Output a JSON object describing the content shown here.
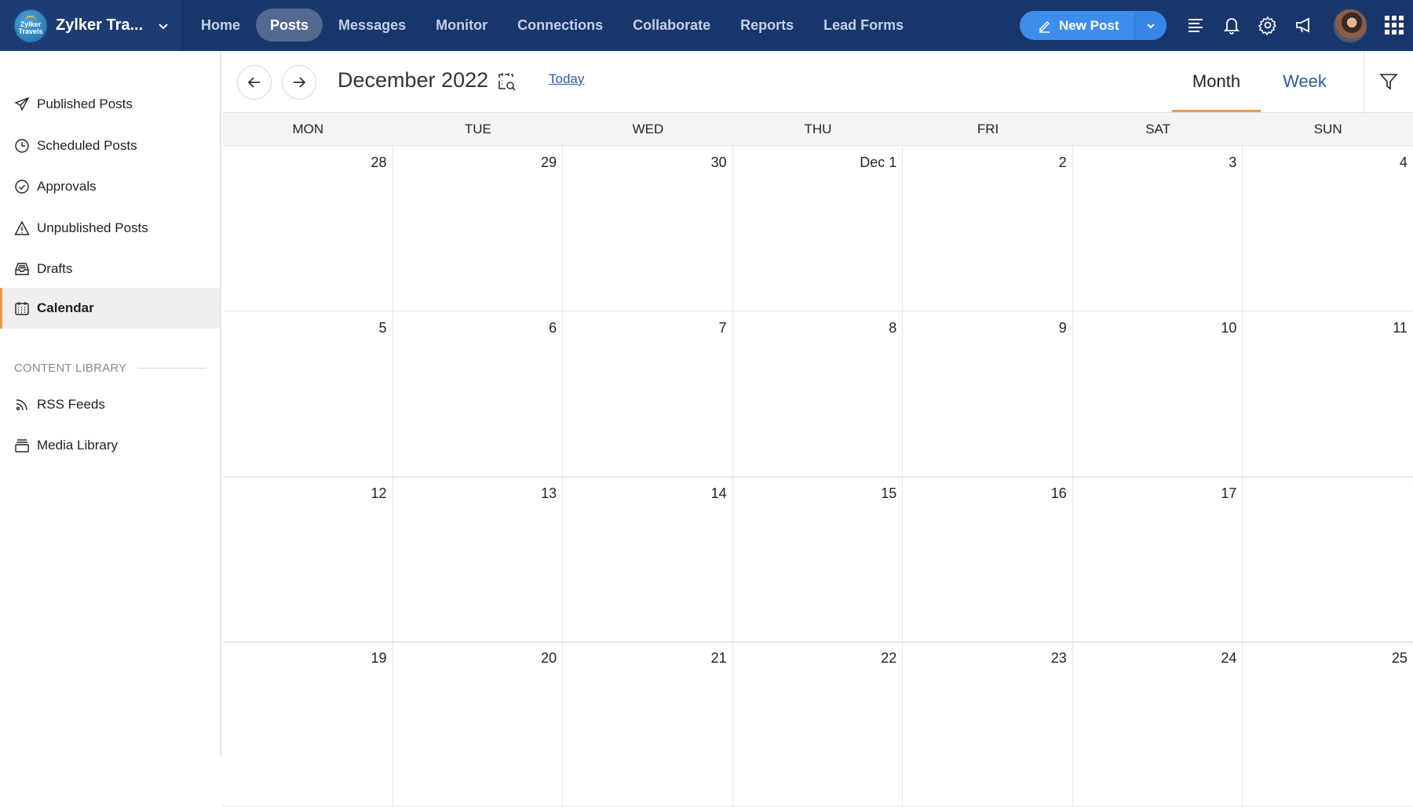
{
  "brand": {
    "name": "Zylker Tra...",
    "logo_text_1": "Zylker",
    "logo_text_2": "Travels"
  },
  "nav": {
    "items": [
      "Home",
      "Posts",
      "Messages",
      "Monitor",
      "Connections",
      "Collaborate",
      "Reports",
      "Lead Forms"
    ],
    "active": "Posts"
  },
  "actions": {
    "new_post_label": "New Post",
    "icons": [
      "list-icon",
      "bell-icon",
      "gear-icon",
      "megaphone-icon",
      "avatar",
      "apps-grid-icon"
    ]
  },
  "sidebar": {
    "items": [
      {
        "label": "Published Posts",
        "icon": "paper-plane-icon"
      },
      {
        "label": "Scheduled Posts",
        "icon": "clock-icon"
      },
      {
        "label": "Approvals",
        "icon": "check-circle-icon"
      },
      {
        "label": "Unpublished Posts",
        "icon": "warning-icon"
      },
      {
        "label": "Drafts",
        "icon": "inbox-icon"
      },
      {
        "label": "Calendar",
        "icon": "calendar-icon",
        "active": true
      }
    ],
    "section_title": "CONTENT LIBRARY",
    "library_items": [
      {
        "label": "RSS Feeds",
        "icon": "rss-icon"
      },
      {
        "label": "Media Library",
        "icon": "media-stack-icon"
      }
    ]
  },
  "calendar": {
    "title": "December 2022",
    "today_label": "Today",
    "views": {
      "month": "Month",
      "week": "Week",
      "active": "Month"
    },
    "weekdays": [
      "MON",
      "TUE",
      "WED",
      "THU",
      "FRI",
      "SAT",
      "SUN"
    ],
    "weeks": [
      [
        "28",
        "29",
        "30",
        "Dec 1",
        "2",
        "3",
        "4"
      ],
      [
        "5",
        "6",
        "7",
        "8",
        "9",
        "10",
        "11"
      ],
      [
        "12",
        "13",
        "14",
        "15",
        "16",
        "17",
        ""
      ],
      [
        "19",
        "20",
        "21",
        "22",
        "23",
        "24",
        "25"
      ]
    ]
  },
  "colors": {
    "topbar": "#18366b",
    "accent_orange": "#f09a4f",
    "button_blue": "#3d8ded",
    "link_blue": "#2a5bab"
  }
}
